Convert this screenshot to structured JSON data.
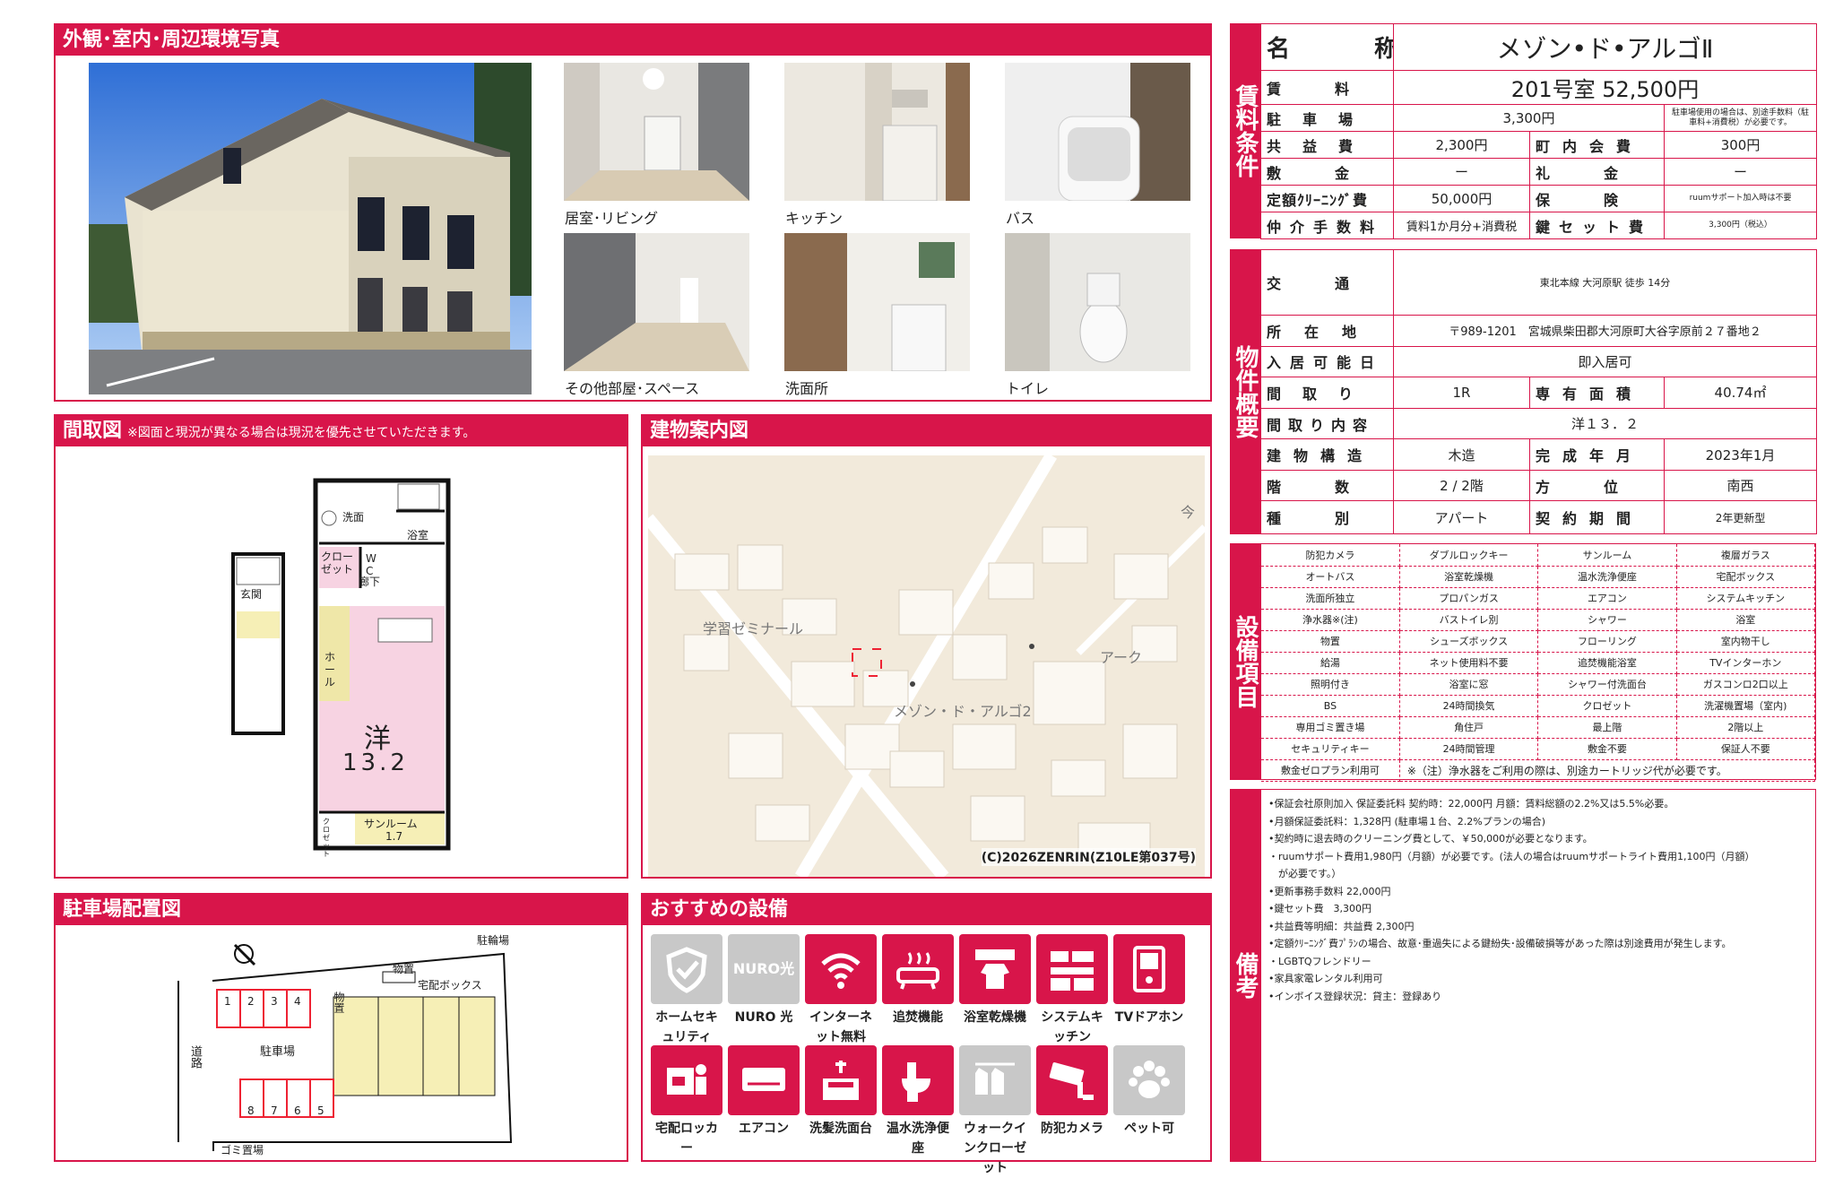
{
  "sections": {
    "photos": "外観･室内･周辺環境写真",
    "floorplan": "間取図",
    "floorplan_note": "※図面と現況が異なる場合は現況を優先させていただきます。",
    "map": "建物案内図",
    "parking": "駐車場配置図",
    "recommend": "おすすめの設備"
  },
  "photo_captions": [
    "居室･リビング",
    "キッチン",
    "バス",
    "その他部屋･スペース",
    "洗面所",
    "トイレ"
  ],
  "floorplan_labels": {
    "senmen": "洗面",
    "yokushitsu": "浴室",
    "closet": "クロー\nゼット",
    "wc": "W\nC",
    "rouka": "廊下",
    "genkan": "玄関",
    "hall": "ホ\nー\nル",
    "room": "洋",
    "room_size": "13.2",
    "sunroom": "サンルーム",
    "sunroom_size": "1.7",
    "closet2": "ク\nロ\nゼ\nッ\nト"
  },
  "map": {
    "label_school": "学習ゼミナール",
    "label_building": "メゾン・ド・アルゴ2",
    "label_ark": "アーク",
    "label_ima": "今",
    "copyright": "(C)2026ZENRIN(Z10LE第037号)"
  },
  "parking": {
    "bike": "駐輪場",
    "storage": "物置",
    "storage2": "物置",
    "delivery": "宅配ボックス",
    "lot": "駐車場",
    "road": "道路",
    "garbage": "ゴミ置場",
    "spaces_top": [
      "1",
      "2",
      "3",
      "4"
    ],
    "spaces_bottom": [
      "8",
      "7",
      "6",
      "5"
    ]
  },
  "recommend": [
    {
      "label": "ホームセキュリティ",
      "icon": "shield-icon",
      "gray": true
    },
    {
      "label": "NURO 光",
      "icon": "nuro-icon",
      "gray": true,
      "text": "NURO光"
    },
    {
      "label": "インターネット無料",
      "icon": "wifi-icon"
    },
    {
      "label": "追焚機能",
      "icon": "bathtub-icon"
    },
    {
      "label": "浴室乾燥機",
      "icon": "bath-dryer-icon"
    },
    {
      "label": "システムキッチン",
      "icon": "kitchen-icon"
    },
    {
      "label": "TVドアホン",
      "icon": "intercom-icon"
    },
    {
      "label": "宅配ロッカー",
      "icon": "locker-icon"
    },
    {
      "label": "エアコン",
      "icon": "aircon-icon"
    },
    {
      "label": "洗髪洗面台",
      "icon": "sink-icon"
    },
    {
      "label": "温水洗浄便座",
      "icon": "toilet-icon"
    },
    {
      "label": "ウォークインクローゼット",
      "icon": "closet-icon",
      "gray": true
    },
    {
      "label": "防犯カメラ",
      "icon": "camera-icon"
    },
    {
      "label": "ペット可",
      "icon": "pet-icon",
      "gray": true
    }
  ],
  "tabs": {
    "rent": "賃料条件",
    "overview": "物件概要",
    "equipment": "設備項目",
    "notes": "備考"
  },
  "rent": {
    "name_k": "名　　　称",
    "name_v": "メゾン•ド•アルゴⅡ",
    "rent_k": "賃料",
    "rent_v": "201号室 52,500円",
    "parking_k": "駐車場",
    "parking_v": "3,300円",
    "parking_note": "駐車場使用の場合は、別途手数料（駐車料+消費税）が必要です。",
    "common_k": "共益費",
    "common_v": "2,300円",
    "town_k": "町内会費",
    "town_v": "300円",
    "deposit_k": "敷金",
    "deposit_v": "ー",
    "key_money_k": "礼金",
    "key_money_v": "ー",
    "cleaning_k": "定額ｸﾘｰﾆﾝｸﾞ費",
    "cleaning_v": "50,000円",
    "insurance_k": "保険",
    "insurance_v": "ruumサポート加入時は不要",
    "agent_k": "仲介手数料",
    "agent_v": "賃料1か月分+消費税",
    "keyset_k": "鍵セット費",
    "keyset_v": "3,300円（税込）"
  },
  "overview": {
    "traffic_k": "交通",
    "traffic_v": "東北本線 大河原駅 徒歩 14分",
    "address_k": "所在地",
    "address_v": "〒989-1201　宮城県柴田郡大河原町大谷字原前２７番地２",
    "movein_k": "入居可能日",
    "movein_v": "即入居可",
    "layout_k": "間取り",
    "layout_v": "1R",
    "area_k": "専有面積",
    "area_v": "40.74㎡",
    "detail_k": "間取り内容",
    "detail_v": "洋１３．２",
    "structure_k": "建物構造",
    "structure_v": "木造",
    "built_k": "完成年月",
    "built_v": "2023年1月",
    "floor_k": "階数",
    "floor_v": "2 / 2階",
    "direction_k": "方位",
    "direction_v": "南西",
    "type_k": "種別",
    "type_v": "アパート",
    "contract_k": "契約期間",
    "contract_v": "2年更新型"
  },
  "equipment": [
    [
      "防犯カメラ",
      "ダブルロックキー",
      "サンルーム",
      "複層ガラス"
    ],
    [
      "オートバス",
      "浴室乾燥機",
      "温水洗浄便座",
      "宅配ボックス"
    ],
    [
      "洗面所独立",
      "プロパンガス",
      "エアコン",
      "システムキッチン"
    ],
    [
      "浄水器※(注)",
      "バストイレ別",
      "シャワー",
      "浴室"
    ],
    [
      "物置",
      "シューズボックス",
      "フローリング",
      "室内物干し"
    ],
    [
      "給湯",
      "ネット使用料不要",
      "追焚機能浴室",
      "TVインターホン"
    ],
    [
      "照明付き",
      "浴室に窓",
      "シャワー付洗面台",
      "ガスコンロ2口以上"
    ],
    [
      "BS",
      "24時間換気",
      "クロゼット",
      "洗濯機置場（室内)"
    ],
    [
      "専用ゴミ置き場",
      "角住戸",
      "最上階",
      "2階以上"
    ],
    [
      "セキュリティキー",
      "24時間管理",
      "敷金不要",
      "保証人不要"
    ]
  ],
  "equipment_last": {
    "first": "敷金ゼロプラン利用可",
    "note": "※（注）浄水器をご利用の際は、別途カートリッジ代が必要です。"
  },
  "notes": [
    "•保証会社原則加入 保証委託料 契約時：22,000円 月額：賃料総額の2.2%又は5.5%必要。",
    "•月額保証委託料：1,328円 (駐車場１台、2.2%プランの場合)",
    "•契約時に退去時のクリーニング費として、￥50,000が必要となります。",
    "・ruumサポート費用1,980円（月額）が必要です。(法人の場合はruumサポートライト費用1,100円（月額）",
    "　が必要です。）",
    "•更新事務手数料 22,000円",
    "•鍵セット費　3,300円",
    "•共益費等明細：共益費 2,300円",
    "•定額ｸﾘｰﾆﾝｸﾞ費ﾌﾟﾗﾝの場合、故意･重過失による鍵紛失･設備破損等があった際は別途費用が発生します。",
    "・LGBTQフレンドリー",
    "•家具家電レンタル利用可",
    "•インボイス登録状況：貸主：登録あり"
  ],
  "colors": {
    "accent": "#d8154a",
    "map_bg": "#f2eadb",
    "road": "#ffffff",
    "building": "#fbf8f2",
    "sunroom": "#f6efb6",
    "room": "#f7d3e2",
    "hall": "#efe7a8"
  }
}
